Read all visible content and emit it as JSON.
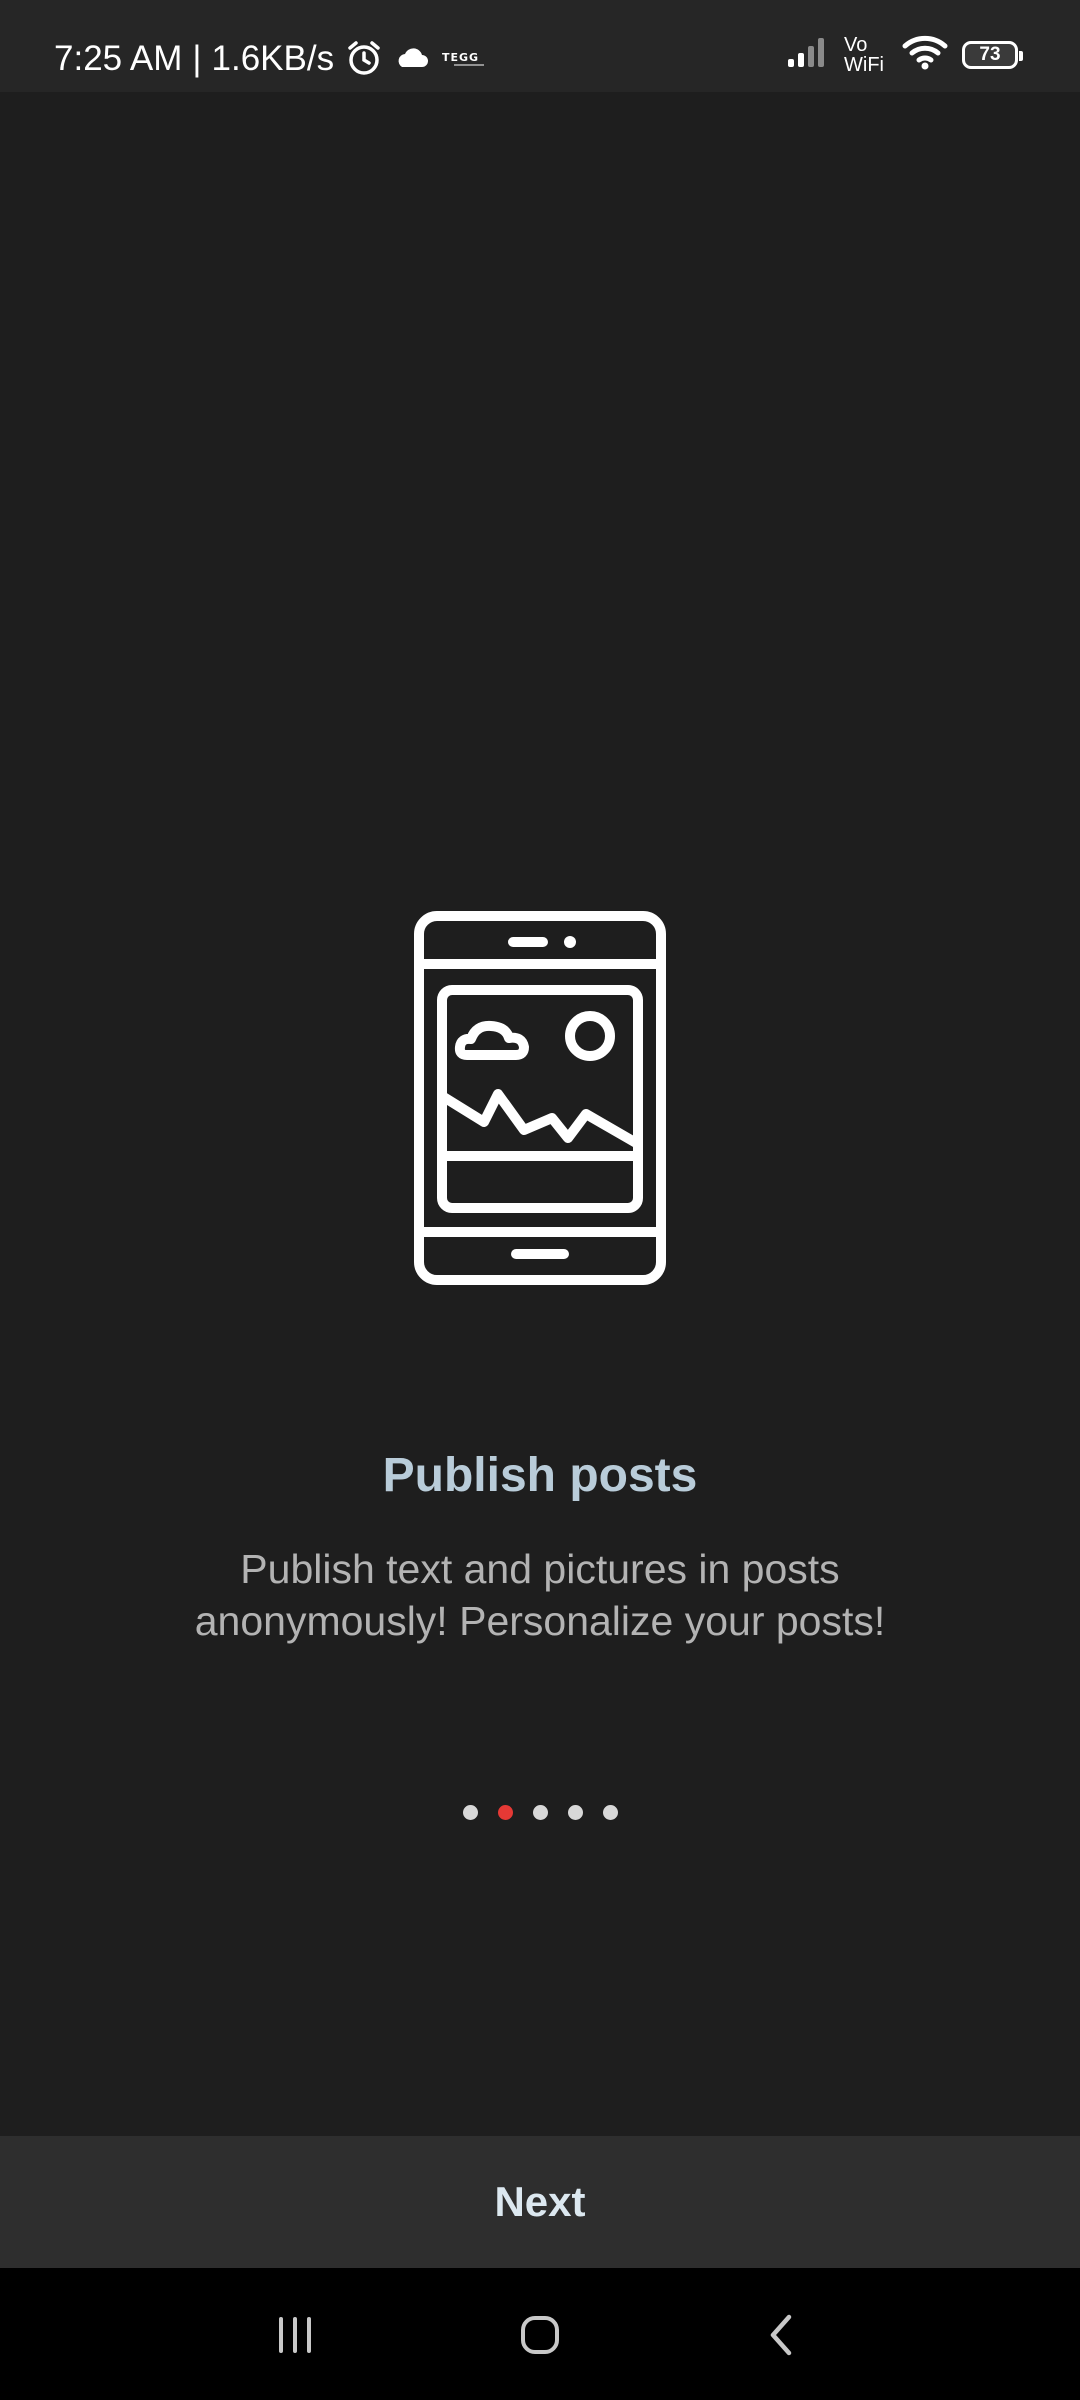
{
  "status_bar": {
    "time": "7:25 AM",
    "separator": "|",
    "speed": "1.6KB/s",
    "carrier_logo_text": "TEGG",
    "vowifi_top": "Vo",
    "vowifi_bottom": "WiFi",
    "battery": "73",
    "icons": [
      "alarm-icon",
      "cloud-icon",
      "signal-icon",
      "wifi-icon",
      "battery-icon"
    ]
  },
  "onboarding": {
    "illustration_icon": "phone-gallery-icon",
    "title": "Publish posts",
    "description": "Publish text and pictures in posts anonymously! Personalize your posts!",
    "page_indicator": {
      "total": 5,
      "active_index": 1
    }
  },
  "footer": {
    "next_label": "Next"
  },
  "navigation_bar": {
    "icons": [
      "recent-apps-icon",
      "home-icon",
      "back-icon"
    ]
  },
  "colors": {
    "background": "#1e1e1e",
    "title": "#b9ccd9",
    "description": "#b3b3b3",
    "active_dot": "#e53935",
    "inactive_dot": "#d8d8d8",
    "next_bar": "#2e2e2e"
  }
}
